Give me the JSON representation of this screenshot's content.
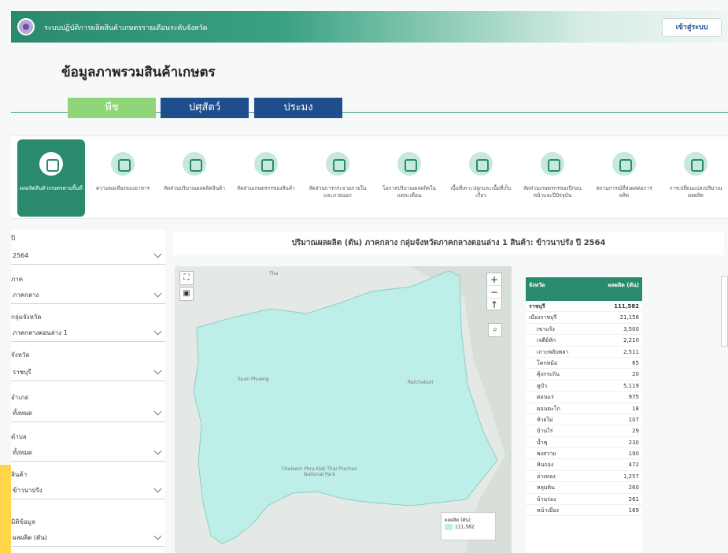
{
  "header": {
    "system_name": "ระบบปฏิบัติการผลิตสินค้าเกษตรรายเดือนระดับจังหวัด",
    "login_label": "เข้าสู่ระบบ"
  },
  "page_title": "ข้อมูลภาพรวมสินค้าเกษตร",
  "category_tabs": [
    "พืช",
    "ปศุสัตว์",
    "ประมง"
  ],
  "menu_items": [
    "ผลผลิตสินค้าเกษตรตามพื้นที่",
    "ความพอเพียงของอาหาร",
    "สัดส่วนปริมาณผลผลิตสินค้า",
    "สัดส่วนเกษตรกรของสินค้า",
    "สัดส่วนการกระจายภายในและภายนอก",
    "โอกาสปริมาณผลผลิตในแต่ละเดือน",
    "เนื้อที่เพาะปลูกและเนื้อที่เก็บเกี่ยว",
    "สัดส่วนเกษตรกรของปีก่อนหน้าและปีปัจจุบัน",
    "สถานการณ์ที่ส่งผลต่อการผลิต",
    "การเปลี่ยนแปลงปริมาณผลผลิต"
  ],
  "filters": [
    {
      "label": "ปี",
      "value": "2564"
    },
    {
      "label": "ภาค",
      "value": "ภาคกลาง"
    },
    {
      "label": "กลุ่มจังหวัด",
      "value": "ภาคกลางตอนล่าง 1"
    },
    {
      "label": "จังหวัด",
      "value": "ราชบุรี"
    },
    {
      "label": "อำเภอ",
      "value": "ทั้งหมด"
    },
    {
      "label": "ตำบล",
      "value": "ทั้งหมด"
    },
    {
      "label": "สินค้า",
      "value": "ข้าวนาปรัง"
    },
    {
      "label": "มิติข้อมูล",
      "value": "ผลผลิต (ตัน)"
    }
  ],
  "chart_title": "ปริมาณผลผลิต (ตัน) ภาคกลาง กลุ่มจังหวัดภาคกลางตอนล่าง 1 สินค้า: ข้าวนาปรัง ปี 2564",
  "map": {
    "zoom_in": "+",
    "zoom_out": "−",
    "reset": "↑",
    "labels": [
      "Tha",
      "Suan Phueng",
      "Ratchaburi",
      "Chaloem Phra Kiat Thai Prachan National Park"
    ],
    "legend_title": "ผลผลิต (ตัน)",
    "legend_value": "111,582",
    "fill_color": "#bdeee8"
  },
  "table": {
    "headers": [
      "จังหวัด",
      "ผลผลิต (ตัน)"
    ],
    "rows": [
      {
        "name": "ราชบุรี",
        "value": "111,582",
        "level": 0
      },
      {
        "name": "เมืองราชบุรี",
        "value": "21,158",
        "level": 1
      },
      {
        "name": "เขาแร้ง",
        "value": "3,500",
        "level": 2
      },
      {
        "name": "เจดีย์หัก",
        "value": "2,210",
        "level": 2
      },
      {
        "name": "เกาะพลับพลา",
        "value": "2,511",
        "level": 2
      },
      {
        "name": "โคกหม้อ",
        "value": "65",
        "level": 2
      },
      {
        "name": "คุ้งกระถิน",
        "value": "20",
        "level": 2
      },
      {
        "name": "คูบัว",
        "value": "5,119",
        "level": 2
      },
      {
        "name": "ดอนแร่",
        "value": "975",
        "level": 2
      },
      {
        "name": "ดอนตะโก",
        "value": "18",
        "level": 2
      },
      {
        "name": "ห้วยไผ่",
        "value": "107",
        "level": 2
      },
      {
        "name": "บ้านไร่",
        "value": "29",
        "level": 2
      },
      {
        "name": "น้ำพุ",
        "value": "230",
        "level": 2
      },
      {
        "name": "พงสวาย",
        "value": "190",
        "level": 2
      },
      {
        "name": "หินกอง",
        "value": "472",
        "level": 2
      },
      {
        "name": "อ่างทอง",
        "value": "1,257",
        "level": 2
      },
      {
        "name": "หลุมดิน",
        "value": "260",
        "level": 2
      },
      {
        "name": "บ้านร่อง",
        "value": "261",
        "level": 2
      },
      {
        "name": "หน้าเมือง",
        "value": "169",
        "level": 2
      }
    ]
  }
}
